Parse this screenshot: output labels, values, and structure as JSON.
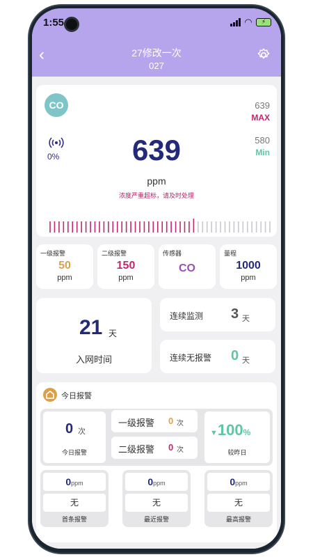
{
  "status": {
    "time": "1:55"
  },
  "header": {
    "title": "27修改一次",
    "subtitle": "027"
  },
  "reading": {
    "gas": "CO",
    "signal_pct": "0%",
    "value": "639",
    "unit": "ppm",
    "warning": "浓度严重超标，请及时处理",
    "max_value": "639",
    "max_label": "MAX",
    "min_value": "580",
    "min_label": "Min"
  },
  "specs": [
    {
      "label": "一级报警",
      "value": "50",
      "unit": "ppm",
      "color": "#d9a24a"
    },
    {
      "label": "二级报警",
      "value": "150",
      "unit": "ppm",
      "color": "#c3276e"
    },
    {
      "label": "传感器",
      "value": "CO",
      "unit": "",
      "color": "#9b4fb5"
    },
    {
      "label": "量程",
      "value": "1000",
      "unit": "ppm",
      "color": "#232a7a"
    }
  ],
  "network": {
    "days": "21",
    "day_unit": "天",
    "label": "入网时间"
  },
  "continuous_monitor": {
    "label": "连续监测",
    "value": "3",
    "unit": "天"
  },
  "continuous_no_alarm": {
    "label": "连续无报警",
    "value": "0",
    "unit": "天"
  },
  "today": {
    "title": "今日报警",
    "count": "0",
    "count_unit": "次",
    "count_label": "今日报警",
    "level1_label": "一级报警",
    "level1_value": "0",
    "level2_label": "二级报警",
    "level2_value": "0",
    "level_unit": "次",
    "change_value": "100",
    "change_unit": "%",
    "change_label": "较昨日",
    "records": [
      {
        "value": "0",
        "unit": "ppm",
        "status": "无",
        "label": "首条报警"
      },
      {
        "value": "0",
        "unit": "ppm",
        "status": "无",
        "label": "最近报警"
      },
      {
        "value": "0",
        "unit": "ppm",
        "status": "无",
        "label": "最高报警"
      }
    ]
  },
  "colors": {
    "header_bg": "#b6a5ec",
    "primary": "#232a7a",
    "alarm": "#c3276e",
    "ok": "#5fc6a2",
    "level1": "#d9a24a"
  }
}
